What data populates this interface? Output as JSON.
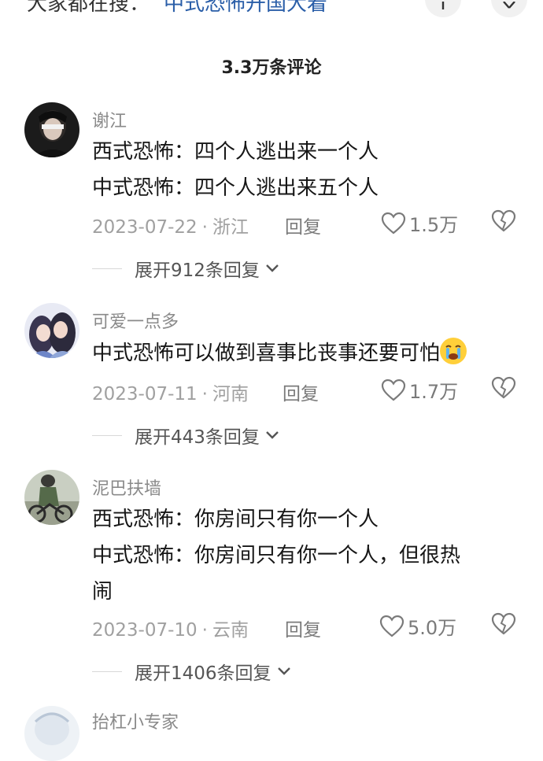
{
  "search_bar": {
    "prefix": "大家都在搜：",
    "term": "中式恐怖开国大着"
  },
  "header": {
    "comment_count": "3.3万条评论"
  },
  "comments": [
    {
      "username": "谢江",
      "lines": [
        "西式恐怖：四个人逃出来一个人",
        "中式恐怖：四个人逃出来五个人"
      ],
      "date": "2023-07-22",
      "location": "浙江",
      "reply_label": "回复",
      "likes": "1.5万",
      "expand_label": "展开912条回复"
    },
    {
      "username": "可爱一点多",
      "lines": [
        "中式恐怖可以做到喜事比丧事还要可怕"
      ],
      "date": "2023-07-11",
      "location": "河南",
      "reply_label": "回复",
      "likes": "1.7万",
      "expand_label": "展开443条回复"
    },
    {
      "username": "泥巴扶墙",
      "lines": [
        "西式恐怖：你房间只有你一个人",
        "中式恐怖：你房间只有你一个人，但很热",
        "闹"
      ],
      "date": "2023-07-10",
      "location": "云南",
      "reply_label": "回复",
      "likes": "5.0万",
      "expand_label": "展开1406条回复"
    },
    {
      "username": "抬杠小专家"
    }
  ],
  "colors": {
    "link_blue": "#2a5ea8",
    "meta_gray": "#a0a0a0",
    "emoji_yellow": "#ffcf3a"
  },
  "icons": [
    "plus-icon",
    "close-icon",
    "heart-icon",
    "broken-heart-icon",
    "chevron-down-icon",
    "crying-face-emoji"
  ]
}
